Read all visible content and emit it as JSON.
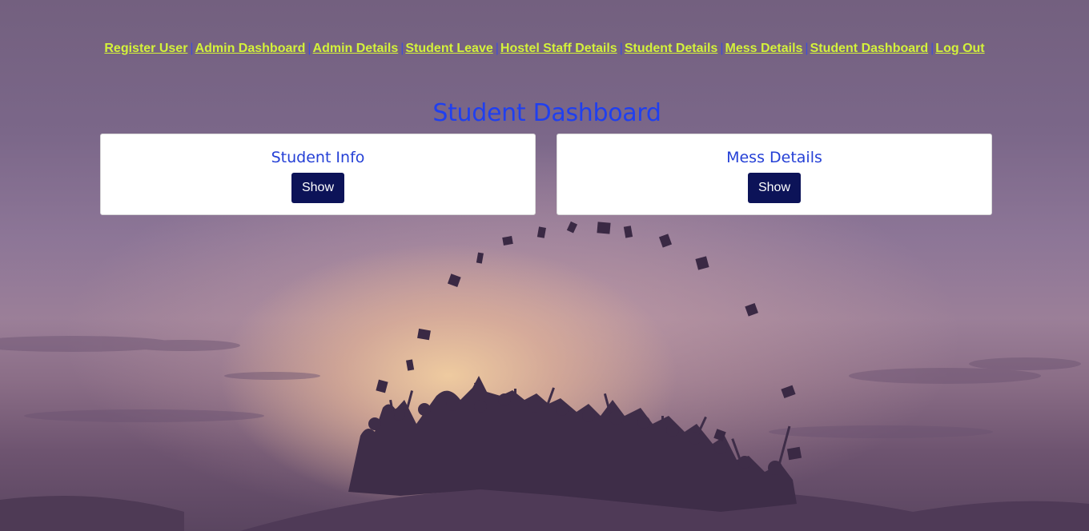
{
  "nav": {
    "links": [
      "Register User",
      "Admin Dashboard",
      "Admin Details",
      "Student Leave",
      "Hostel Staff Details",
      "Student Details",
      "Mess Details",
      "Student Dashboard",
      "Log Out"
    ],
    "separator": "|",
    "link_color": "#d4f23a"
  },
  "page": {
    "title": "Student Dashboard",
    "title_color": "#1f3ff0"
  },
  "cards": [
    {
      "title": "Student Info",
      "button_label": "Show"
    },
    {
      "title": "Mess Details",
      "button_label": "Show"
    }
  ],
  "colors": {
    "card_title": "#2540d6",
    "button_bg": "#0c1358",
    "button_text": "#ffffff"
  }
}
